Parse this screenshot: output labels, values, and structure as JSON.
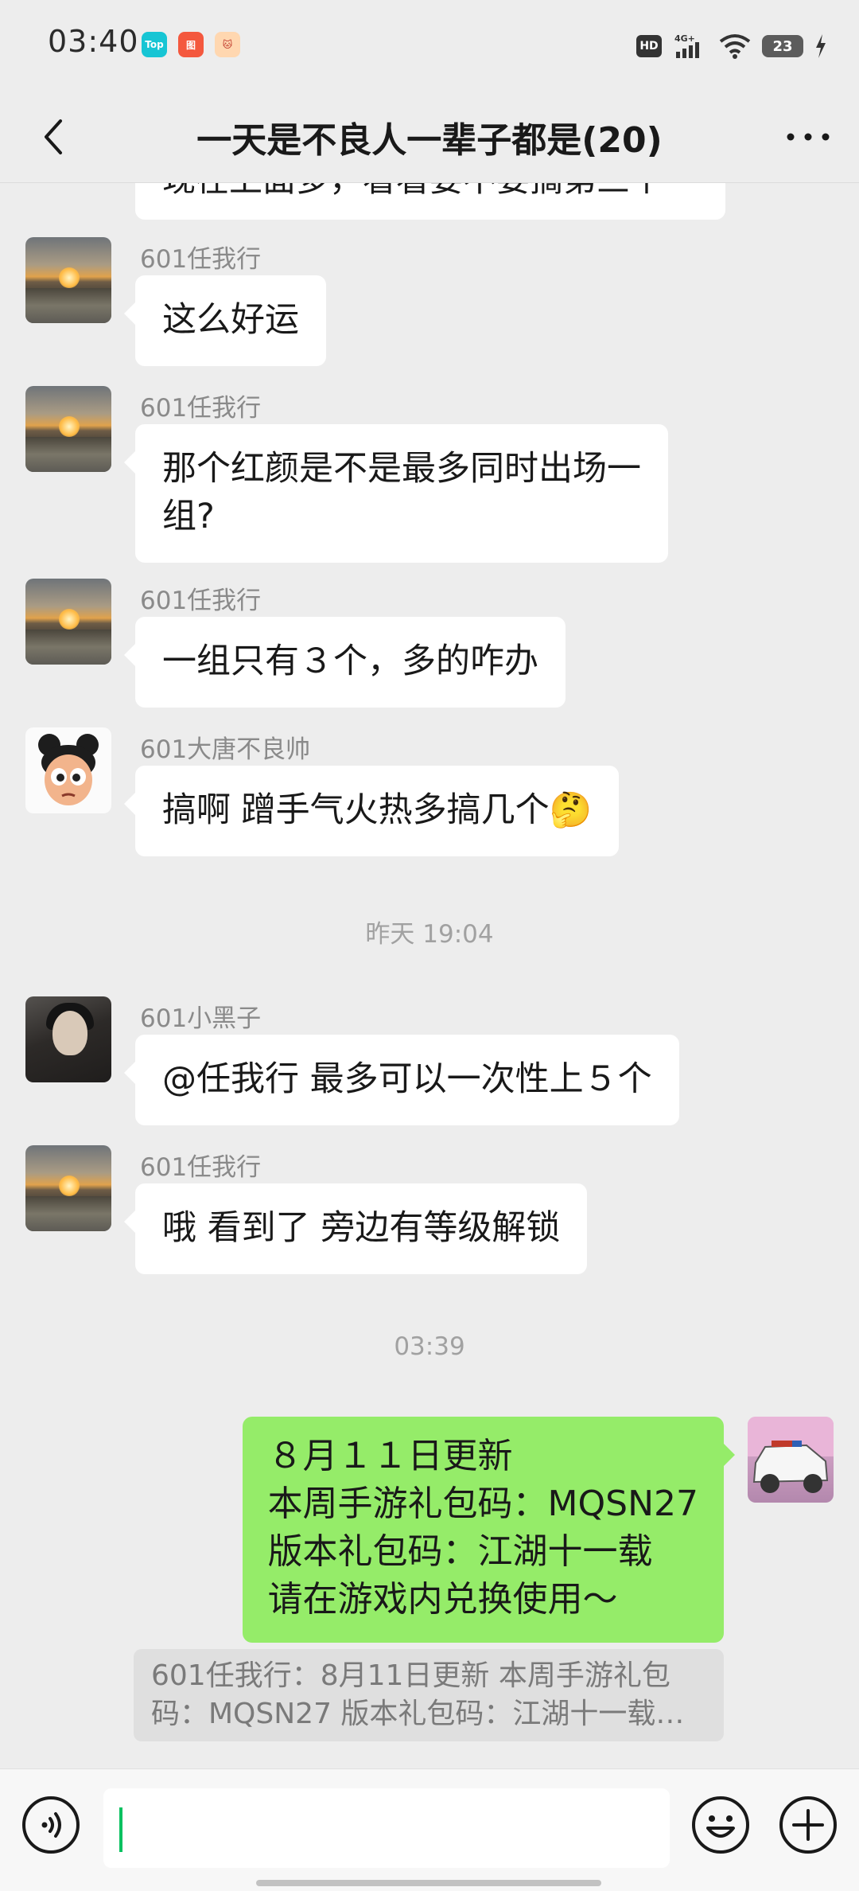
{
  "status_bar": {
    "time": "03:40",
    "apps": [
      "Top",
      "图",
      "🐱"
    ],
    "hd": "HD",
    "network": "4G+",
    "battery": "23"
  },
  "header": {
    "back_icon": "chevron-left-icon",
    "title": "一天是不良人一辈子都是(20)",
    "more_icon": "more-dots-icon"
  },
  "messages": {
    "cut_text": "现在上面多，看看要不要搞第三个",
    "m1": {
      "sender": "601任我行",
      "lines": [
        "这么好运"
      ]
    },
    "m2": {
      "sender": "601任我行",
      "lines": [
        "那个红颜是不是最多同时出场一",
        "组?"
      ]
    },
    "m3": {
      "sender": "601任我行",
      "lines": [
        "一组只有３个，多的咋办"
      ]
    },
    "m4": {
      "sender": "601大唐不良帅",
      "lines": [
        "搞啊 蹭手气火热多搞几个"
      ],
      "emoji": "🤔"
    },
    "sep1": "昨天 19:04",
    "m5": {
      "sender": "601小黑子",
      "lines": [
        "@任我行  最多可以一次性上５个"
      ]
    },
    "m6": {
      "sender": "601任我行",
      "lines": [
        "哦 看到了 旁边有等级解锁"
      ]
    },
    "sep2": "03:39",
    "self_msg": {
      "lines": [
        "８月１１日更新",
        "本周手游礼包码：MQSN27",
        "版本礼包码：江湖十一载",
        "请在游戏内兑换使用～"
      ]
    },
    "quote": {
      "lines": [
        "601任我行：8月11日更新 本周手游礼包",
        "码：MQSN27 版本礼包码：江湖十一载…"
      ]
    }
  },
  "input_bar": {
    "voice_icon": "voice-icon",
    "emoji_icon": "emoji-icon",
    "plus_icon": "plus-icon",
    "text_value": ""
  },
  "colors": {
    "background": "#ededed",
    "self_bubble": "#95ec69",
    "caret": "#07c160"
  }
}
